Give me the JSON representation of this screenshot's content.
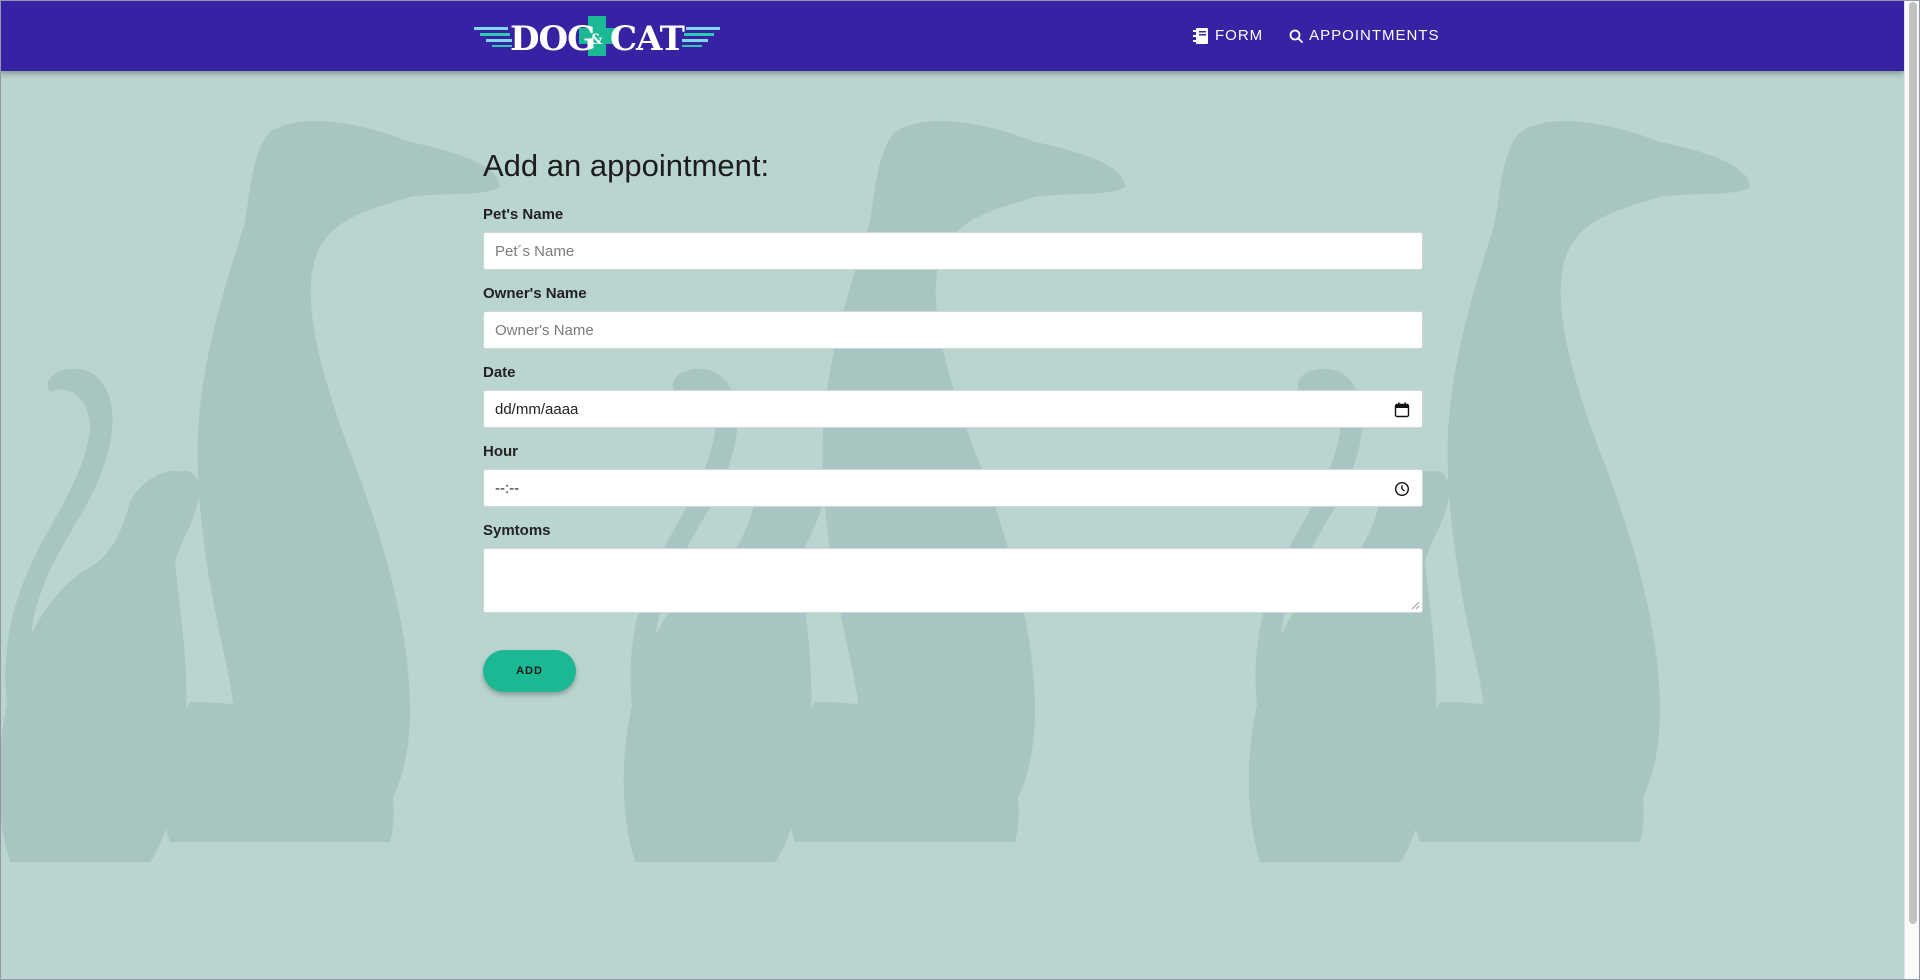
{
  "brand": {
    "logo_text_left": "DOG",
    "logo_text_mid": "&",
    "logo_text_right": "CAT"
  },
  "nav": {
    "links": [
      {
        "label": "Form",
        "icon": "book-icon"
      },
      {
        "label": "Appointments",
        "icon": "search-icon"
      }
    ]
  },
  "form": {
    "title": "Add an appointment:",
    "pet_name": {
      "label": "Pet's Name",
      "placeholder": "Pet´s Name",
      "value": ""
    },
    "owner_name": {
      "label": "Owner's Name",
      "placeholder": "Owner's Name",
      "value": ""
    },
    "date": {
      "label": "Date",
      "display": "dd/mm/aaaa",
      "icon": "calendar-icon"
    },
    "hour": {
      "label": "Hour",
      "display": "--:--",
      "icon": "clock-icon"
    },
    "symptoms": {
      "label": "Symtoms",
      "value": ""
    },
    "submit_label": "Add"
  },
  "colors": {
    "navbar": "#3822a4",
    "background": "#bad4d0",
    "silhouette": "#a9c5c1",
    "button": "#1bb993",
    "logo_accent": "#1bb993"
  }
}
